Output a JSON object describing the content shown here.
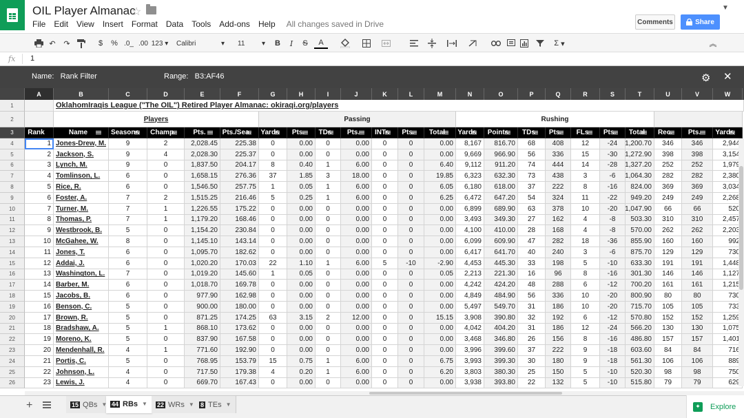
{
  "doc": {
    "title": "OIL Player Almanac",
    "saved_status": "All changes saved in Drive"
  },
  "menu": [
    "File",
    "Edit",
    "View",
    "Insert",
    "Format",
    "Data",
    "Tools",
    "Add-ons",
    "Help"
  ],
  "buttons": {
    "comments": "Comments",
    "share": "Share"
  },
  "toolbar": {
    "currency": "$",
    "percent": "%",
    "dec_dec": ".0_",
    "dec_inc": ".00",
    "format_more": "123",
    "font": "Calibri",
    "size": "11",
    "bold": "B",
    "italic": "I",
    "strike": "S",
    "textcolor": "A",
    "sum": "Σ"
  },
  "formula_bar": {
    "fx": "fx",
    "value": "1"
  },
  "filter_bar": {
    "name_label": "Name:",
    "name_value": "Rank Filter",
    "range_label": "Range:",
    "range_value": "B3:AF46"
  },
  "columns": [
    "A",
    "B",
    "C",
    "D",
    "E",
    "F",
    "G",
    "H",
    "I",
    "J",
    "K",
    "L",
    "M",
    "N",
    "O",
    "P",
    "Q",
    "R",
    "S",
    "T",
    "U",
    "V",
    "W"
  ],
  "banner": "OklahomIraqis League (\"The OIL\") Retired Player Almanac: okiraqi.org/players",
  "groups": {
    "players": "Players",
    "passing": "Passing",
    "rushing": "Rushing"
  },
  "headers": [
    "Rank",
    "Name",
    "Seasons",
    "Champ.",
    "Pts.",
    "Pts./Sea.",
    "Yards",
    "Pts.",
    "TDs",
    "Pts.",
    "INTs",
    "Pts.",
    "Total",
    "Yards",
    "Points",
    "TDs",
    "Pts.",
    "FLs",
    "Pts.",
    "Total",
    "Rec.",
    "Pts.",
    "Yards"
  ],
  "row_numbers": [
    "1",
    "2",
    "3",
    "4",
    "5",
    "6",
    "7",
    "8",
    "9",
    "10",
    "11",
    "12",
    "13",
    "14",
    "15",
    "16",
    "17",
    "18",
    "19",
    "20",
    "21",
    "22",
    "23",
    "24",
    "25",
    "26"
  ],
  "rows": [
    [
      "1",
      "Jones-Drew, M.",
      "9",
      "2",
      "2,028.45",
      "225.38",
      "0",
      "0.00",
      "0",
      "0.00",
      "0",
      "0",
      "0.00",
      "8,167",
      "816.70",
      "68",
      "408",
      "12",
      "-24",
      "1,200.70",
      "346",
      "346",
      "2,944"
    ],
    [
      "2",
      "Jackson, S.",
      "9",
      "4",
      "2,028.30",
      "225.37",
      "0",
      "0.00",
      "0",
      "0.00",
      "0",
      "0",
      "0.00",
      "9,669",
      "966.90",
      "56",
      "336",
      "15",
      "-30",
      "1,272.90",
      "398",
      "398",
      "3,154"
    ],
    [
      "3",
      "Lynch, M.",
      "9",
      "0",
      "1,837.50",
      "204.17",
      "8",
      "0.40",
      "1",
      "6.00",
      "0",
      "0",
      "6.40",
      "9,112",
      "911.20",
      "74",
      "444",
      "14",
      "-28",
      "1,327.20",
      "252",
      "252",
      "1,979"
    ],
    [
      "4",
      "Tomlinson, L.",
      "6",
      "0",
      "1,658.15",
      "276.36",
      "37",
      "1.85",
      "3",
      "18.00",
      "0",
      "0",
      "19.85",
      "6,323",
      "632.30",
      "73",
      "438",
      "3",
      "-6",
      "1,064.30",
      "282",
      "282",
      "2,380"
    ],
    [
      "5",
      "Rice, R.",
      "6",
      "0",
      "1,546.50",
      "257.75",
      "1",
      "0.05",
      "1",
      "6.00",
      "0",
      "0",
      "6.05",
      "6,180",
      "618.00",
      "37",
      "222",
      "8",
      "-16",
      "824.00",
      "369",
      "369",
      "3,034"
    ],
    [
      "6",
      "Foster, A.",
      "7",
      "2",
      "1,515.25",
      "216.46",
      "5",
      "0.25",
      "1",
      "6.00",
      "0",
      "0",
      "6.25",
      "6,472",
      "647.20",
      "54",
      "324",
      "11",
      "-22",
      "949.20",
      "249",
      "249",
      "2,268"
    ],
    [
      "7",
      "Turner, M.",
      "7",
      "1",
      "1,226.55",
      "175.22",
      "0",
      "0.00",
      "0",
      "0.00",
      "0",
      "0",
      "0.00",
      "6,899",
      "689.90",
      "63",
      "378",
      "10",
      "-20",
      "1,047.90",
      "66",
      "66",
      "520"
    ],
    [
      "8",
      "Thomas, P.",
      "7",
      "1",
      "1,179.20",
      "168.46",
      "0",
      "0.00",
      "0",
      "0.00",
      "0",
      "0",
      "0.00",
      "3,493",
      "349.30",
      "27",
      "162",
      "4",
      "-8",
      "503.30",
      "310",
      "310",
      "2,457"
    ],
    [
      "9",
      "Westbrook, B.",
      "5",
      "0",
      "1,154.20",
      "230.84",
      "0",
      "0.00",
      "0",
      "0.00",
      "0",
      "0",
      "0.00",
      "4,100",
      "410.00",
      "28",
      "168",
      "4",
      "-8",
      "570.00",
      "262",
      "262",
      "2,203"
    ],
    [
      "10",
      "McGahee, W.",
      "8",
      "0",
      "1,145.10",
      "143.14",
      "0",
      "0.00",
      "0",
      "0.00",
      "0",
      "0",
      "0.00",
      "6,099",
      "609.90",
      "47",
      "282",
      "18",
      "-36",
      "855.90",
      "160",
      "160",
      "992"
    ],
    [
      "11",
      "Jones, T.",
      "6",
      "0",
      "1,095.70",
      "182.62",
      "0",
      "0.00",
      "0",
      "0.00",
      "0",
      "0",
      "0.00",
      "6,417",
      "641.70",
      "40",
      "240",
      "3",
      "-6",
      "875.70",
      "129",
      "129",
      "730"
    ],
    [
      "12",
      "Addai, J.",
      "6",
      "0",
      "1,020.20",
      "170.03",
      "22",
      "1.10",
      "1",
      "6.00",
      "5",
      "-10",
      "-2.90",
      "4,453",
      "445.30",
      "33",
      "198",
      "5",
      "-10",
      "633.30",
      "191",
      "191",
      "1,448"
    ],
    [
      "13",
      "Washington, L.",
      "7",
      "0",
      "1,019.20",
      "145.60",
      "1",
      "0.05",
      "0",
      "0.00",
      "0",
      "0",
      "0.05",
      "2,213",
      "221.30",
      "16",
      "96",
      "8",
      "-16",
      "301.30",
      "146",
      "146",
      "1,127"
    ],
    [
      "14",
      "Barber, M.",
      "6",
      "0",
      "1,018.70",
      "169.78",
      "0",
      "0.00",
      "0",
      "0.00",
      "0",
      "0",
      "0.00",
      "4,242",
      "424.20",
      "48",
      "288",
      "6",
      "-12",
      "700.20",
      "161",
      "161",
      "1,215"
    ],
    [
      "15",
      "Jacobs, B.",
      "6",
      "0",
      "977.90",
      "162.98",
      "0",
      "0.00",
      "0",
      "0.00",
      "0",
      "0",
      "0.00",
      "4,849",
      "484.90",
      "56",
      "336",
      "10",
      "-20",
      "800.90",
      "80",
      "80",
      "730"
    ],
    [
      "16",
      "Benson, C.",
      "5",
      "0",
      "900.00",
      "180.00",
      "0",
      "0.00",
      "0",
      "0.00",
      "0",
      "0",
      "0.00",
      "5,497",
      "549.70",
      "31",
      "186",
      "10",
      "-20",
      "715.70",
      "105",
      "105",
      "733"
    ],
    [
      "17",
      "Brown, R.",
      "5",
      "0",
      "871.25",
      "174.25",
      "63",
      "3.15",
      "2",
      "12.00",
      "0",
      "0",
      "15.15",
      "3,908",
      "390.80",
      "32",
      "192",
      "6",
      "-12",
      "570.80",
      "152",
      "152",
      "1,259"
    ],
    [
      "18",
      "Bradshaw, A.",
      "5",
      "1",
      "868.10",
      "173.62",
      "0",
      "0.00",
      "0",
      "0.00",
      "0",
      "0",
      "0.00",
      "4,042",
      "404.20",
      "31",
      "186",
      "12",
      "-24",
      "566.20",
      "130",
      "130",
      "1,075"
    ],
    [
      "19",
      "Moreno, K.",
      "5",
      "0",
      "837.90",
      "167.58",
      "0",
      "0.00",
      "0",
      "0.00",
      "0",
      "0",
      "0.00",
      "3,468",
      "346.80",
      "26",
      "156",
      "8",
      "-16",
      "486.80",
      "157",
      "157",
      "1,401"
    ],
    [
      "20",
      "Mendenhall, R.",
      "4",
      "1",
      "771.60",
      "192.90",
      "0",
      "0.00",
      "0",
      "0.00",
      "0",
      "0",
      "0.00",
      "3,996",
      "399.60",
      "37",
      "222",
      "9",
      "-18",
      "603.60",
      "84",
      "84",
      "716"
    ],
    [
      "21",
      "Portis, C.",
      "5",
      "0",
      "768.95",
      "153.79",
      "15",
      "0.75",
      "1",
      "6.00",
      "0",
      "0",
      "6.75",
      "3,993",
      "399.30",
      "30",
      "180",
      "9",
      "-18",
      "561.30",
      "106",
      "106",
      "889"
    ],
    [
      "22",
      "Johnson, L.",
      "4",
      "0",
      "717.50",
      "179.38",
      "4",
      "0.20",
      "1",
      "6.00",
      "0",
      "0",
      "6.20",
      "3,803",
      "380.30",
      "25",
      "150",
      "5",
      "-10",
      "520.30",
      "98",
      "98",
      "750"
    ],
    [
      "23",
      "Lewis, J.",
      "4",
      "0",
      "669.70",
      "167.43",
      "0",
      "0.00",
      "0",
      "0.00",
      "0",
      "0",
      "0.00",
      "3,938",
      "393.80",
      "22",
      "132",
      "5",
      "-10",
      "515.80",
      "79",
      "79",
      "629"
    ]
  ],
  "tabs": [
    {
      "count": "15",
      "label": "QBs"
    },
    {
      "count": "44",
      "label": "RBs"
    },
    {
      "count": "22",
      "label": "WRs"
    },
    {
      "count": "8",
      "label": "TEs"
    }
  ],
  "explore": "Explore",
  "colors": {
    "header_bg": "#444444",
    "filter_bar": "#424242",
    "accent": "#0f9d58",
    "share": "#4d90fe",
    "selection": "#4285f4"
  }
}
